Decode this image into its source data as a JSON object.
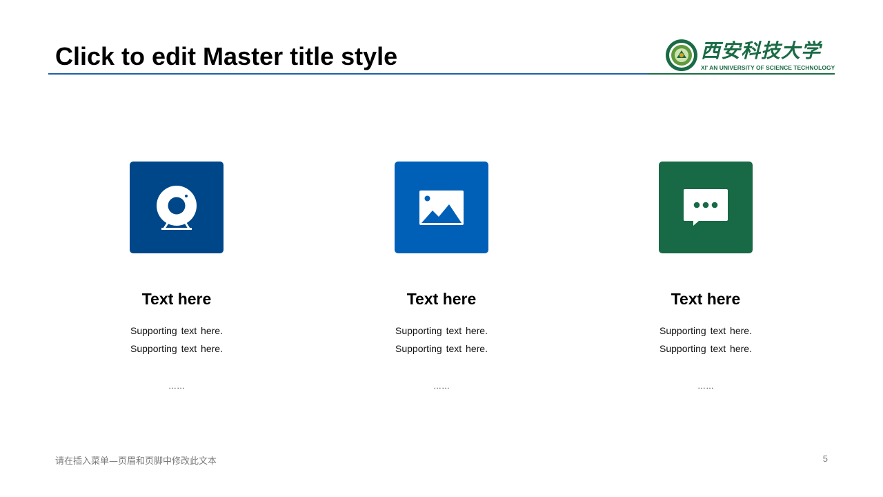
{
  "title": "Click to edit Master title style",
  "logo": {
    "name_cn": "西安科技大学",
    "name_en": "XI' AN UNIVERSITY OF SCIENCE TECHNOLOGY",
    "color": "#1a6b45"
  },
  "cards": [
    {
      "icon": "webcam-icon",
      "color": "#00478a",
      "heading": "Text here",
      "line1": "Supporting text here.",
      "line2": "Supporting text here.",
      "ellipsis": "……"
    },
    {
      "icon": "image-icon",
      "color": "#0060b8",
      "heading": "Text here",
      "line1": "Supporting text here.",
      "line2": "Supporting text here.",
      "ellipsis": "……"
    },
    {
      "icon": "chat-icon",
      "color": "#186945",
      "heading": "Text here",
      "line1": "Supporting text here.",
      "line2": "Supporting text here.",
      "ellipsis": "……"
    }
  ],
  "footer": {
    "text": "请在插入菜单—页眉和页脚中修改此文本",
    "page_number": "5"
  }
}
